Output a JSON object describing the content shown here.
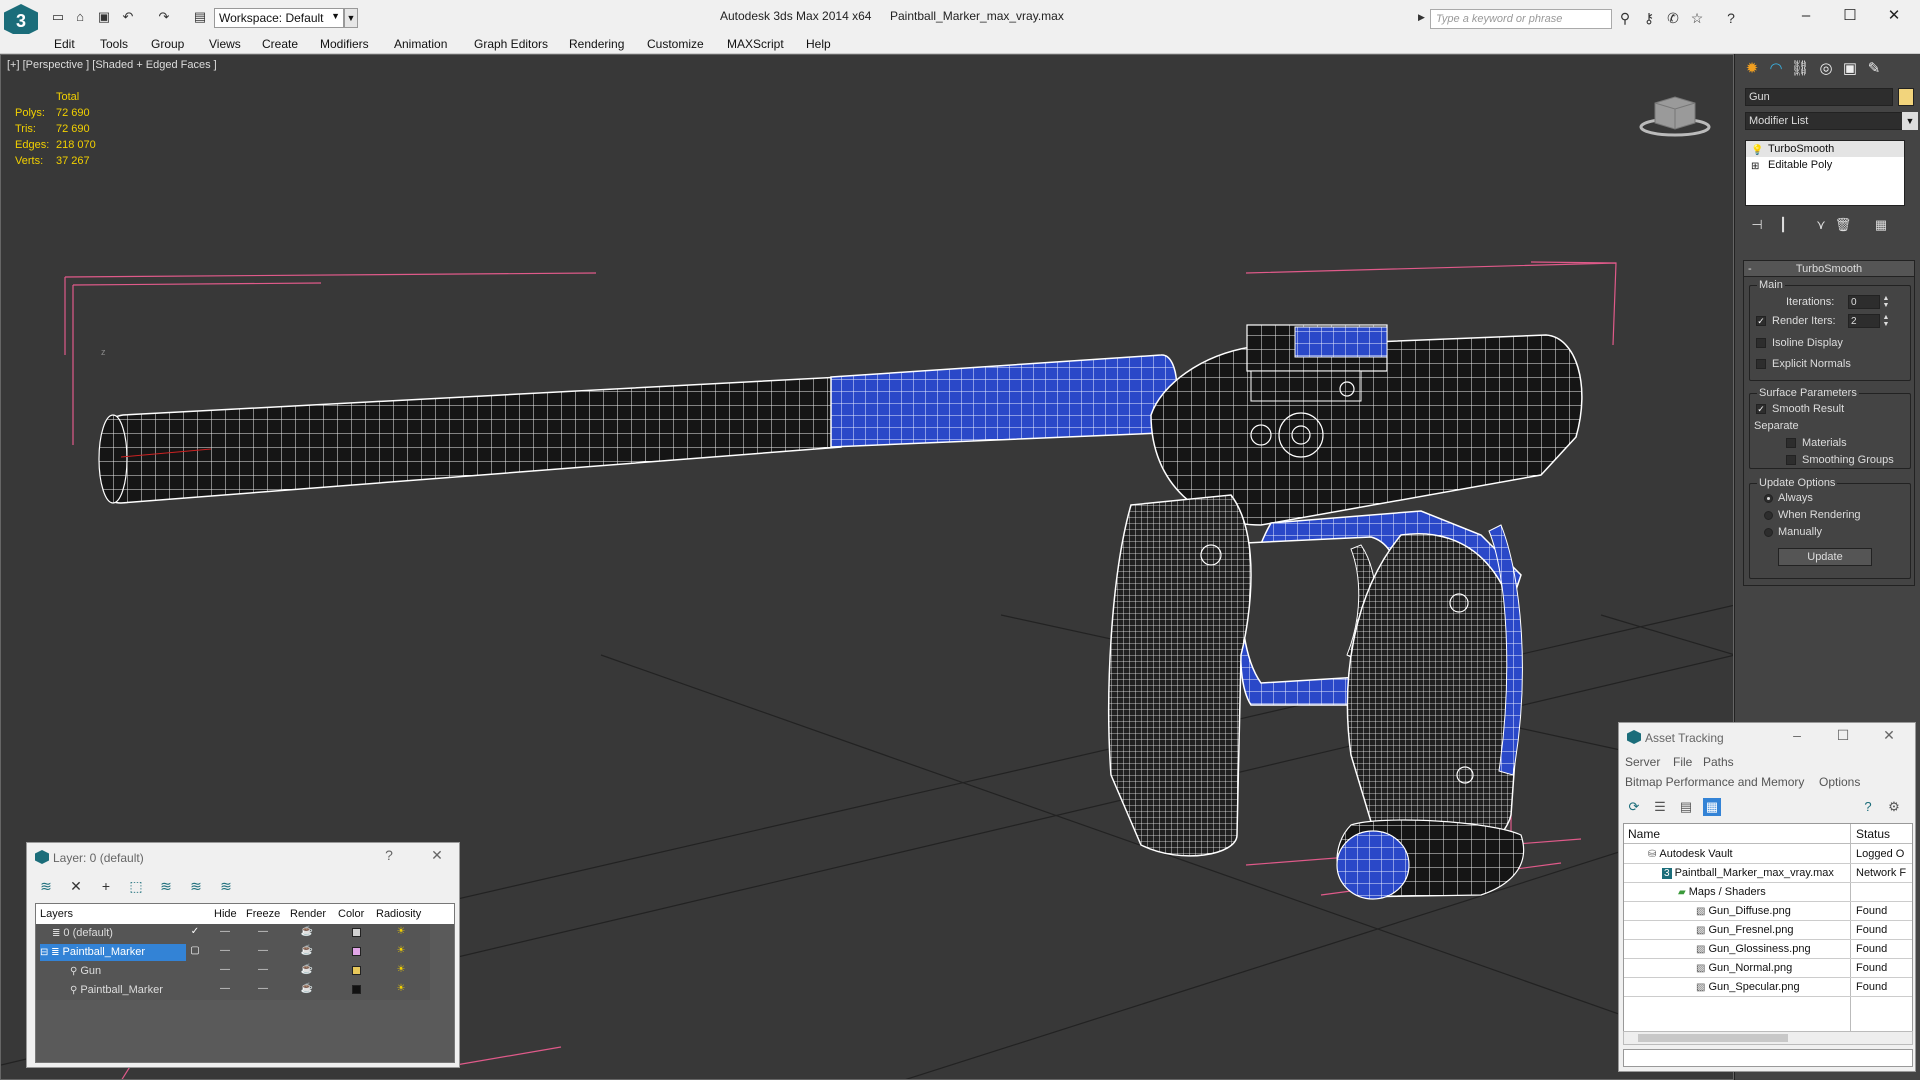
{
  "titlebar": {
    "app_title": "Autodesk 3ds Max  2014 x64",
    "file_name": "Paintball_Marker_max_vray.max",
    "workspace": "Workspace: Default",
    "search_placeholder": "Type a keyword or phrase"
  },
  "menu": [
    "Edit",
    "Tools",
    "Group",
    "Views",
    "Create",
    "Modifiers",
    "Animation",
    "Graph Editors",
    "Rendering",
    "Customize",
    "MAXScript",
    "Help"
  ],
  "viewport": {
    "label": "[+] [Perspective ] [Shaded + Edged Faces ]",
    "stats": {
      "header": "Total",
      "rows": [
        {
          "k": "Polys:",
          "v": "72 690"
        },
        {
          "k": "Tris:",
          "v": "72 690"
        },
        {
          "k": "Edges:",
          "v": "218 070"
        },
        {
          "k": "Verts:",
          "v": "37 267"
        }
      ]
    }
  },
  "command_panel": {
    "object_name": "Gun",
    "modifier_list": "Modifier List",
    "stack": [
      "TurboSmooth",
      "Editable Poly"
    ],
    "rollout": {
      "title": "TurboSmooth",
      "main": "Main",
      "iterations_label": "Iterations:",
      "iterations": "0",
      "render_iters_label": "Render Iters:",
      "render_iters": "2",
      "isoline": "Isoline Display",
      "explicit_normals": "Explicit Normals",
      "surface_params": "Surface Parameters",
      "smooth_result": "Smooth Result",
      "separate": "Separate",
      "materials": "Materials",
      "smoothing_groups": "Smoothing Groups",
      "update_options": "Update Options",
      "always": "Always",
      "when_rendering": "When Rendering",
      "manually": "Manually",
      "update_button": "Update"
    }
  },
  "layer_dialog": {
    "title": "Layer: 0 (default)",
    "columns": [
      "Layers",
      "Hide",
      "Freeze",
      "Render",
      "Color",
      "Radiosity"
    ],
    "rows": [
      {
        "name": "0 (default)",
        "color": "#d0d0d0"
      },
      {
        "name": "Paintball_Marker",
        "color": "#e2a6e8"
      },
      {
        "name": "Gun",
        "color": "#e8c85a"
      },
      {
        "name": "Paintball_Marker",
        "color": "#111111"
      }
    ]
  },
  "asset_dialog": {
    "title": "Asset Tracking",
    "menu1": [
      "Server",
      "File",
      "Paths"
    ],
    "menu2": [
      "Bitmap Performance and Memory",
      "Options"
    ],
    "columns": [
      "Name",
      "Status"
    ],
    "rows": [
      {
        "name": "Autodesk Vault",
        "status": "Logged O"
      },
      {
        "name": "Paintball_Marker_max_vray.max",
        "status": "Network F"
      },
      {
        "name": "Maps / Shaders",
        "status": ""
      },
      {
        "name": "Gun_Diffuse.png",
        "status": "Found"
      },
      {
        "name": "Gun_Fresnel.png",
        "status": "Found"
      },
      {
        "name": "Gun_Glossiness.png",
        "status": "Found"
      },
      {
        "name": "Gun_Normal.png",
        "status": "Found"
      },
      {
        "name": "Gun_Specular.png",
        "status": "Found"
      }
    ]
  }
}
